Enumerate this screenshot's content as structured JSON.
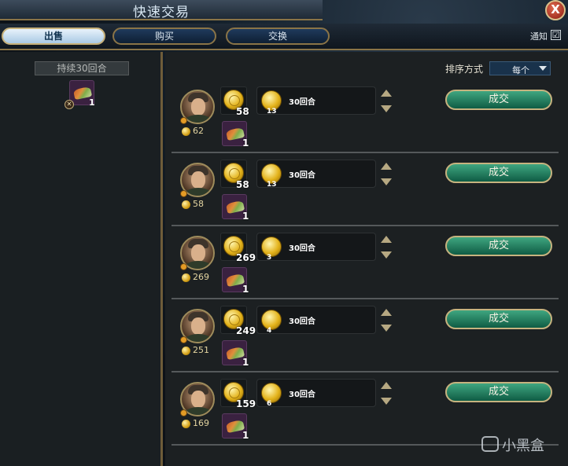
{
  "window": {
    "title": "快速交易",
    "close_label": "X"
  },
  "tabs": [
    {
      "label": "出售",
      "active": true
    },
    {
      "label": "购买",
      "active": false
    },
    {
      "label": "交换",
      "active": false
    }
  ],
  "notify": {
    "label": "通知",
    "checked": true,
    "check_glyph": "☑"
  },
  "left": {
    "duration_label": "持续30回合",
    "resource_qty": "1",
    "resource_icon": "tradeable-resource-icon"
  },
  "sort": {
    "label": "排序方式",
    "value": "每个"
  },
  "offers": [
    {
      "leader_icon": "leader-portrait-helmet",
      "gold_total": "62",
      "gold_lump": "58",
      "resource_qty": "1",
      "per_turn_qty": "13",
      "per_turn_label": "30回合",
      "deal_label": "成交"
    },
    {
      "leader_icon": "leader-portrait-mustache",
      "gold_total": "58",
      "gold_lump": "58",
      "resource_qty": "1",
      "per_turn_qty": "13",
      "per_turn_label": "30回合",
      "deal_label": "成交"
    },
    {
      "leader_icon": "leader-portrait-hat",
      "gold_total": "269",
      "gold_lump": "269",
      "resource_qty": "1",
      "per_turn_qty": "3",
      "per_turn_label": "30回合",
      "deal_label": "成交"
    },
    {
      "leader_icon": "leader-portrait-crown",
      "gold_total": "251",
      "gold_lump": "249",
      "resource_qty": "1",
      "per_turn_qty": "4",
      "per_turn_label": "30回合",
      "deal_label": "成交"
    },
    {
      "leader_icon": "leader-portrait-turban",
      "gold_total": "169",
      "gold_lump": "159",
      "resource_qty": "1",
      "per_turn_qty": "6",
      "per_turn_label": "30回合",
      "deal_label": "成交"
    }
  ],
  "watermark": {
    "text": "小黑盒"
  },
  "colors": {
    "accent_gold": "#c6b37f",
    "deal_green": "#1f8a62",
    "tab_blue": "#1f3a5c"
  }
}
